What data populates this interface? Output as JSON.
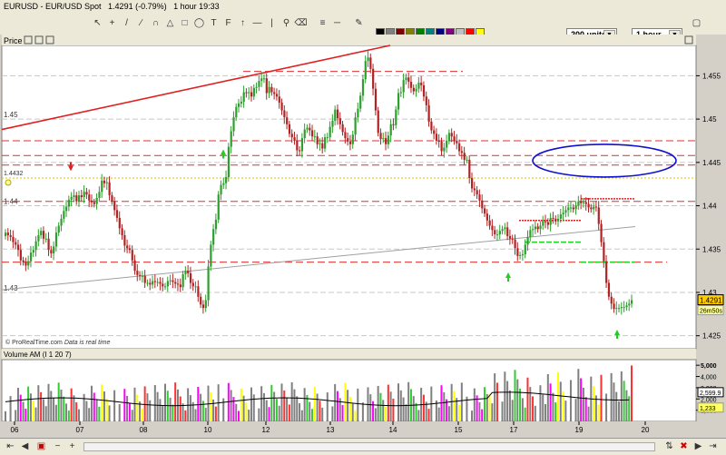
{
  "window": {
    "title": "EURUSD - EUR/USD Spot",
    "price_info": "1.4291 (-0.79%)",
    "interval_info": "1 hour 19:33"
  },
  "controls": {
    "units_select": "200 units",
    "interval_select": "1 hour"
  },
  "colors": {
    "up_candle": "#2e9e2e",
    "down_candle": "#b22222",
    "resistance_dashed": "#e03030",
    "trendline_red": "#e02020",
    "trendline_grey": "#a0a0a0",
    "ellipse": "#1010d0",
    "reference_dotted": "#d8c400",
    "volume_ma": "#000000",
    "background": "#ffffff",
    "palette": [
      "#000000",
      "#808080",
      "#800000",
      "#808000",
      "#008000",
      "#008080",
      "#000080",
      "#800080",
      "#c0c0c0",
      "#ff0000",
      "#ffff00",
      "#00ff00",
      "#00ffff",
      "#0000ff",
      "#ff00ff",
      "#ffffff",
      "#ff8040",
      "#804000",
      "#80ff00",
      "#004080",
      "#8080ff",
      "#ff0080",
      "#ffc0c0",
      "#c0ffc0"
    ]
  },
  "price_panel": {
    "label": "Price",
    "ref_label": "1.4432",
    "last_label": "1.4291",
    "countdown": "26m50s",
    "footer_left": "© ProRealTime.com",
    "footer_right": "Data is real time",
    "y_ticks": [
      "1.455",
      "1.45",
      "1.445",
      "1.44",
      "1.435",
      "1.43",
      "1.425"
    ],
    "left_ticks": [
      "1.45",
      "1.44",
      "1.43"
    ]
  },
  "volume_panel": {
    "label": "Volume AM (I 1 20 7)",
    "y_ticks": [
      "5,000",
      "4,000",
      "3,000",
      "2,000",
      "1,000"
    ],
    "ma_value": "2,599.9",
    "last_value": "1,233"
  },
  "x_axis": {
    "labels": [
      "06",
      "07",
      "08",
      "10",
      "12",
      "13",
      "14",
      "15",
      "17",
      "19",
      "20"
    ]
  },
  "chart_data": {
    "type": "candlestick",
    "symbol": "EURUSD",
    "interval": "1 hour",
    "ylim": [
      1.4235,
      1.4585
    ],
    "reference_level": 1.4432,
    "last_price": 1.4291,
    "horizontal_levels": [
      1.4555,
      1.4475,
      1.4458,
      1.4447,
      1.4405,
      1.4335
    ],
    "closes": [
      1.4369,
      1.4366,
      1.4364,
      1.4358,
      1.4355,
      1.4349,
      1.4337,
      1.4335,
      1.4331,
      1.4336,
      1.4346,
      1.4349,
      1.4359,
      1.4366,
      1.4371,
      1.4362,
      1.4362,
      1.4349,
      1.4345,
      1.4353,
      1.4369,
      1.4377,
      1.4385,
      1.4394,
      1.4399,
      1.4407,
      1.441,
      1.4412,
      1.4405,
      1.4412,
      1.441,
      1.4416,
      1.4413,
      1.4406,
      1.4404,
      1.4402,
      1.4409,
      1.4416,
      1.4429,
      1.4426,
      1.4427,
      1.4412,
      1.4405,
      1.4395,
      1.4386,
      1.4374,
      1.4366,
      1.4354,
      1.4351,
      1.4349,
      1.4337,
      1.4325,
      1.432,
      1.4319,
      1.4319,
      1.4311,
      1.4311,
      1.4309,
      1.4313,
      1.4312,
      1.4312,
      1.431,
      1.4307,
      1.4307,
      1.4313,
      1.4314,
      1.4312,
      1.431,
      1.4309,
      1.4306,
      1.4321,
      1.4325,
      1.4322,
      1.4311,
      1.4307,
      1.4307,
      1.4295,
      1.4286,
      1.4282,
      1.4291,
      1.433,
      1.4355,
      1.4373,
      1.4384,
      1.4413,
      1.4424,
      1.4426,
      1.4433,
      1.4468,
      1.4486,
      1.4502,
      1.4514,
      1.4518,
      1.452,
      1.4531,
      1.453,
      1.4531,
      1.4526,
      1.4536,
      1.4537,
      1.4544,
      1.4547,
      1.4547,
      1.453,
      1.4537,
      1.4531,
      1.4529,
      1.4526,
      1.4519,
      1.451,
      1.4502,
      1.4494,
      1.4483,
      1.4479,
      1.4475,
      1.4464,
      1.4463,
      1.4478,
      1.4488,
      1.449,
      1.4487,
      1.448,
      1.448,
      1.4471,
      1.4472,
      1.4466,
      1.4479,
      1.4479,
      1.4491,
      1.4498,
      1.4511,
      1.4501,
      1.4494,
      1.4485,
      1.4478,
      1.4474,
      1.4471,
      1.4482,
      1.4502,
      1.4512,
      1.4527,
      1.4546,
      1.4567,
      1.4571,
      1.4558,
      1.4535,
      1.451,
      1.4484,
      1.4477,
      1.4478,
      1.4471,
      1.4481,
      1.4494,
      1.4493,
      1.4511,
      1.453,
      1.4531,
      1.4545,
      1.4548,
      1.4543,
      1.4536,
      1.4532,
      1.4535,
      1.4542,
      1.4539,
      1.4526,
      1.4516,
      1.4497,
      1.4487,
      1.4483,
      1.4475,
      1.4474,
      1.4463,
      1.4467,
      1.4475,
      1.4484,
      1.448,
      1.4475,
      1.4472,
      1.4463,
      1.4461,
      1.4453,
      1.4453,
      1.4432,
      1.442,
      1.4418,
      1.4413,
      1.4406,
      1.4397,
      1.4391,
      1.4383,
      1.4377,
      1.4372,
      1.4367,
      1.4367,
      1.4371,
      1.4373,
      1.4375,
      1.4365,
      1.4362,
      1.4361,
      1.4351,
      1.4342,
      1.4343,
      1.4344,
      1.4355,
      1.4364,
      1.4372,
      1.4373,
      1.4376,
      1.4373,
      1.4377,
      1.4382,
      1.4381,
      1.4378,
      1.4386,
      1.4385,
      1.4382,
      1.4385,
      1.439,
      1.4392,
      1.4395,
      1.4398,
      1.4398,
      1.4396,
      1.44,
      1.4405,
      1.4403,
      1.4404,
      1.4402,
      1.4398,
      1.4396,
      1.4399,
      1.4398,
      1.4379,
      1.4358,
      1.4336,
      1.4311,
      1.4295,
      1.4287,
      1.4281,
      1.4282,
      1.4282,
      1.4283,
      1.4283,
      1.4285,
      1.4287,
      1.4291
    ],
    "volume_ma_approx": 2000
  }
}
